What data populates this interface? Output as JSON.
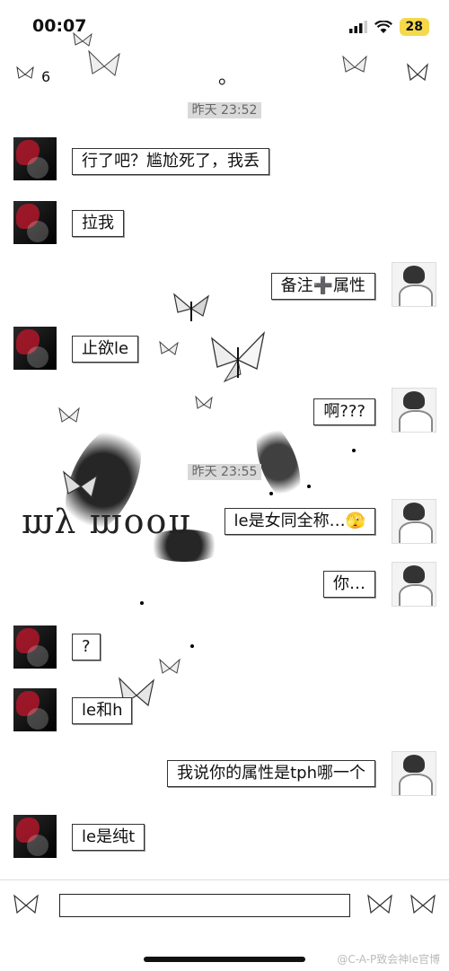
{
  "status_bar": {
    "time": "00:07",
    "battery": "28"
  },
  "header": {
    "unread_count": "6",
    "title": "。"
  },
  "messages": [
    {
      "type": "timestamp",
      "text": "昨天 23:52"
    },
    {
      "type": "message",
      "side": "left",
      "text": "行了吧？尴尬死了，我丢"
    },
    {
      "type": "message",
      "side": "left",
      "text": "拉我"
    },
    {
      "type": "message",
      "side": "right",
      "text": "备注➕属性"
    },
    {
      "type": "message",
      "side": "left",
      "text": "止欲le"
    },
    {
      "type": "message",
      "side": "right",
      "text": "啊???"
    },
    {
      "type": "timestamp",
      "text": "昨天 23:55"
    },
    {
      "type": "message",
      "side": "right",
      "text": "le是女同全称…🫣"
    },
    {
      "type": "message",
      "side": "right",
      "text": "你…"
    },
    {
      "type": "message",
      "side": "left",
      "text": "?"
    },
    {
      "type": "message",
      "side": "left",
      "text": "le和h"
    },
    {
      "type": "message",
      "side": "right",
      "text": "我说你的属性是tph哪一个"
    },
    {
      "type": "message",
      "side": "left",
      "text": "le是纯t"
    }
  ],
  "background_text": "my moon",
  "input_bar": {
    "placeholder": ""
  },
  "watermark": "@C-A-P致会神le官博",
  "icons": {
    "signal": "signal-icon",
    "wifi": "wifi-icon",
    "back": "butterfly-back-icon",
    "menu": "butterfly-menu-icon",
    "voice": "butterfly-voice-icon",
    "emoji": "butterfly-emoji-icon",
    "more": "butterfly-more-icon"
  }
}
